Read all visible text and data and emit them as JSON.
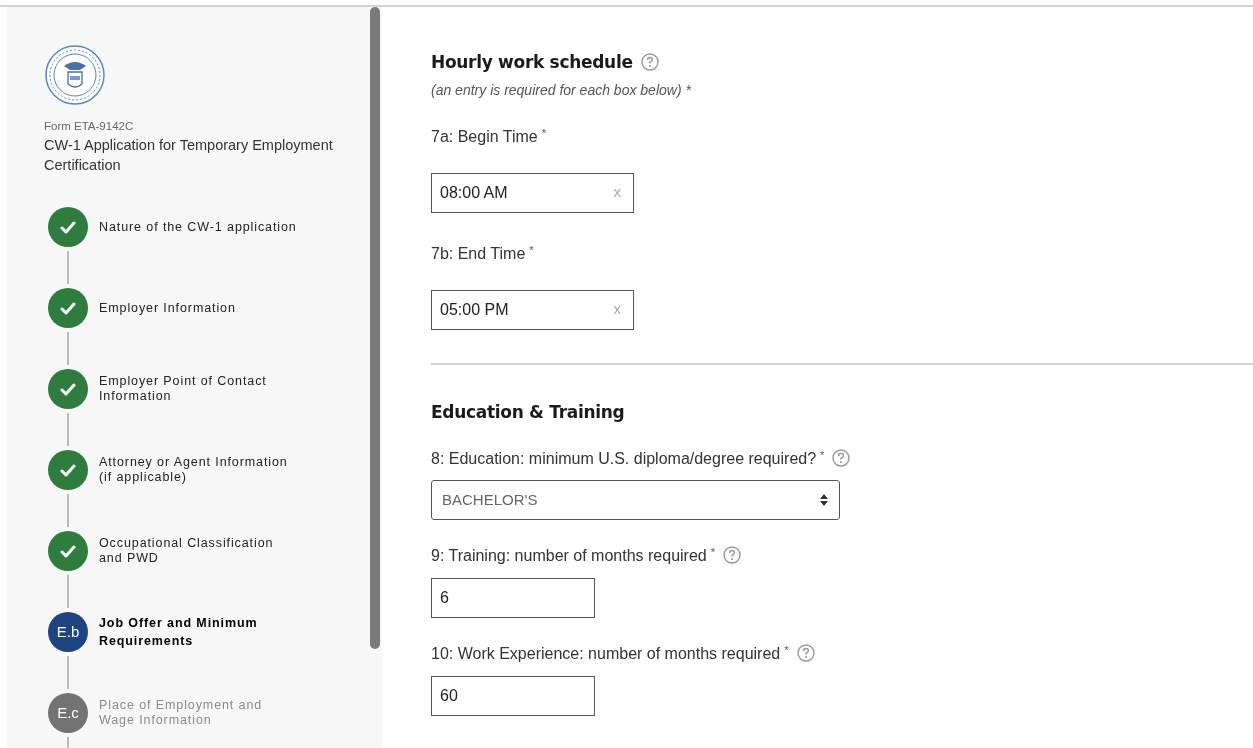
{
  "sidebar": {
    "form_number": "Form ETA-9142C",
    "form_title": "CW-1 Application for Temporary Employment Certification",
    "steps": [
      {
        "label": "Nature of the CW-1 application",
        "kind": "complete"
      },
      {
        "label": "Employer Information",
        "kind": "complete"
      },
      {
        "label": "Employer Point of Contact Information",
        "kind": "complete"
      },
      {
        "label": "Attorney or Agent Information (if applicable)",
        "kind": "complete"
      },
      {
        "label": "Occupational Classification and PWD",
        "kind": "complete"
      },
      {
        "label": "Job Offer and Minimum Requirements",
        "kind": "current",
        "badge": "E.b"
      },
      {
        "label": "Place of Employment and Wage Information",
        "kind": "upcoming",
        "badge": "E.c"
      }
    ]
  },
  "sections": [
    {
      "title": "Hourly work schedule",
      "help": true,
      "note": "(an entry is required for each box below)",
      "note_mark": "*",
      "fields": [
        {
          "kind": "time",
          "label": "7a: Begin Time",
          "required_mark": "*",
          "help": false,
          "value": "08:00 AM",
          "clear": "x"
        },
        {
          "kind": "time",
          "label": "7b: End Time",
          "required_mark": "*",
          "help": false,
          "value": "05:00 PM",
          "clear": "x"
        }
      ]
    },
    {
      "title": "Education & Training",
      "help": false,
      "fields": [
        {
          "kind": "select",
          "label": "8: Education: minimum U.S. diploma/degree required?",
          "required_mark": "*",
          "help": true,
          "value": "BACHELOR'S"
        },
        {
          "kind": "number",
          "label": "9: Training: number of months required",
          "required_mark": "*",
          "help": true,
          "value": "6"
        },
        {
          "kind": "number",
          "label": "10: Work Experience: number of months required",
          "required_mark": "*",
          "help": true,
          "value": "60"
        }
      ]
    }
  ]
}
